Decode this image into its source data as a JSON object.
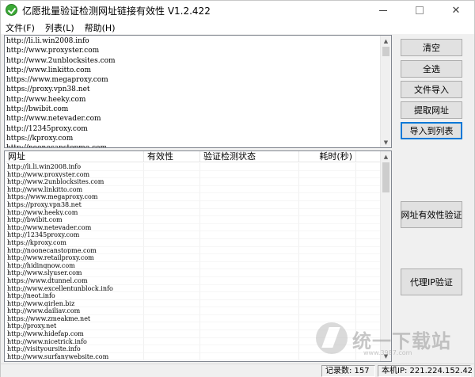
{
  "window": {
    "title": "亿愿批量验证检测网址链接有效性 V1.2.422",
    "minimize_icon": "minimize-icon",
    "maximize_icon": "maximize-icon",
    "close_symbol": "✕"
  },
  "menu": [
    {
      "label": "文件(F)"
    },
    {
      "label": "列表(L)"
    },
    {
      "label": "帮助(H)"
    }
  ],
  "url_input": {
    "lines": [
      "http://li.li.win2008.info",
      "http://www.proxyster.com",
      "http://www.2unblocksites.com",
      "http://www.linkitto.com",
      "https://www.megaproxy.com",
      "https://proxy.vpn38.net",
      "http://www.heeky.com",
      "http://bwibit.com",
      "http://www.netevader.com",
      "http://12345proxy.com",
      "https://kproxy.com",
      "http://noonecanstopme.com"
    ]
  },
  "buttons": {
    "clear": "清空",
    "select_all": "全选",
    "import_file": "文件导入",
    "extract_urls": "提取网址",
    "import_to_list": "导入到列表",
    "validate_urls": "网址有效性验证",
    "proxy_validate": "代理IP验证"
  },
  "table": {
    "columns": [
      "网址",
      "有效性",
      "验证检测状态",
      "耗时(秒)",
      ""
    ],
    "rows": [
      "http://li.li.win2008.info",
      "http://www.proxyster.com",
      "http://www.2unblocksites.com",
      "http://www.linkitto.com",
      "https://www.megaproxy.com",
      "https://proxy.vpn38.net",
      "http://www.heeky.com",
      "http://bwibit.com",
      "http://www.netevader.com",
      "http://12345proxy.com",
      "https://kproxy.com",
      "http://noonecanstopme.com",
      "http://www.retailproxy.com",
      "http://hidingnow.com",
      "http://www.slyuser.com",
      "https://www.dtunnel.com",
      "http://www.excellentunblock.info",
      "http://neot.info",
      "http://www.girlen.biz",
      "http://www.dailiav.com",
      "https://www.zmeakme.net",
      "http://proxy.net",
      "http://www.hidefap.com",
      "http://www.nicetrick.info",
      "http://visityoursite.info",
      "http://www.surfanywebsite.com"
    ]
  },
  "status": {
    "record_count": "记录数: 157",
    "local_ip": "本机IP: 221.224.152.42"
  },
  "watermark": {
    "text": "统一下载站",
    "sub": "www.3987.com"
  },
  "colors": {
    "app_icon": "#3aa935",
    "focus_border": "#0078d7"
  }
}
